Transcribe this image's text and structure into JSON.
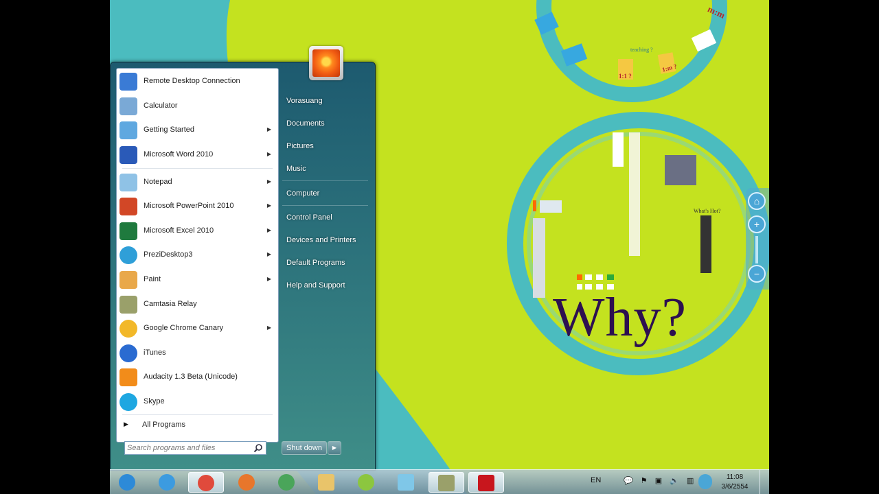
{
  "start_menu": {
    "programs": [
      {
        "label": "Remote Desktop Connection",
        "icon": "remote-desktop-icon",
        "submenu": false
      },
      {
        "label": "Calculator",
        "icon": "calculator-icon",
        "submenu": false
      },
      {
        "label": "Getting Started",
        "icon": "getting-started-icon",
        "submenu": true
      },
      {
        "label": "Microsoft Word 2010",
        "icon": "word-icon",
        "submenu": true
      },
      {
        "label": "Notepad",
        "icon": "notepad-icon",
        "submenu": true
      },
      {
        "label": "Microsoft PowerPoint 2010",
        "icon": "powerpoint-icon",
        "submenu": true
      },
      {
        "label": "Microsoft Excel 2010",
        "icon": "excel-icon",
        "submenu": true
      },
      {
        "label": "PreziDesktop3",
        "icon": "prezi-icon",
        "submenu": true
      },
      {
        "label": "Paint",
        "icon": "paint-icon",
        "submenu": true
      },
      {
        "label": "Camtasia Relay",
        "icon": "camtasia-icon",
        "submenu": false
      },
      {
        "label": "Google Chrome Canary",
        "icon": "chrome-canary-icon",
        "submenu": true
      },
      {
        "label": "iTunes",
        "icon": "itunes-icon",
        "submenu": false
      },
      {
        "label": "Audacity 1.3 Beta (Unicode)",
        "icon": "audacity-icon",
        "submenu": false
      },
      {
        "label": "Skype",
        "icon": "skype-icon",
        "submenu": false
      }
    ],
    "all_programs": "All Programs",
    "search_placeholder": "Search programs and files",
    "right_links": [
      "Vorasuang",
      "Documents",
      "Pictures",
      "Music",
      "Computer",
      "Control Panel",
      "Devices and Printers",
      "Default Programs",
      "Help and Support"
    ],
    "shutdown_label": "Shut down"
  },
  "desktop": {
    "why_text": "Why?",
    "teaching_text": "teaching ?",
    "mm_text": "m:m",
    "one_one_text": "1:1 ?",
    "one_m_text": "1:m ?",
    "whats_hot_text": "What's Hot?"
  },
  "taskbar": {
    "apps": [
      "start-orb-icon",
      "internet-explorer-icon",
      "chrome-icon",
      "firefox-icon",
      "messenger-icon",
      "folder-icon",
      "google-talk-icon",
      "photo-icon",
      "camtasia-icon",
      "flash-icon"
    ],
    "language": "EN",
    "time": "11:08",
    "date": "3/6/2554"
  },
  "colors": {
    "desktop_bg": "#c4e21f",
    "ring_teal": "#4bbcbf",
    "why_text": "#2d1050"
  }
}
